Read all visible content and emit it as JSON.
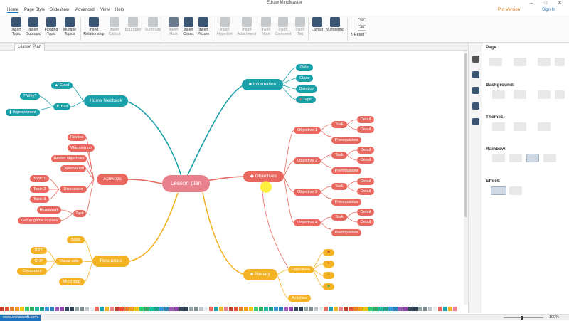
{
  "window": {
    "title": "Edraw MindMaster"
  },
  "menu": {
    "items": [
      "Home",
      "Page Style",
      "Slideshow",
      "Advanced",
      "View",
      "Help"
    ],
    "pro_version": "Pro Version",
    "sign_in": "Sign In"
  },
  "ribbon": {
    "insert_topic": "Insert Topic",
    "insert_subtopic": "Insert Subtopic",
    "floating_topic": "Floating Topic",
    "multiple_topics": "Multiple Topics",
    "insert_relationship": "Insert Relationship",
    "insert_callout": "Insert Callout",
    "boundary": "Boundary",
    "summary": "Summary",
    "insert_mark": "Insert Mark",
    "insert_clipart": "Insert Clipart",
    "insert_picture": "Insert Picture",
    "insert_hyperlink": "Insert Hyperlink",
    "insert_attachment": "Insert Attachment",
    "insert_note": "Insert Note",
    "insert_comment": "Insert Comment",
    "insert_tag": "Insert Tag",
    "layout": "Layout",
    "numbering": "Numbering",
    "spacing_h": "50",
    "spacing_v": "40",
    "reset": "Reset"
  },
  "tabs": [
    "Lesson Plan"
  ],
  "mindmap": {
    "central": "Lesson plan",
    "home_feedback": "Home feedback",
    "good": "Good",
    "bad": "Bad",
    "why": "Why?",
    "improvement": "Improvement",
    "information": "Information",
    "date": "Date",
    "class": "Class",
    "duration": "Duration",
    "topic": "Topic",
    "activities": "Activities",
    "review": "Review",
    "warming_up": "Warming up",
    "revisit_objectives": "Revisit objectives",
    "observation": "Observation",
    "discussion": "Discussion",
    "topic1": "Topic 1",
    "topic2": "Topic 2",
    "topic3": "Topic 3",
    "task": "Task",
    "homework": "Homework",
    "group_game": "Group game in class",
    "resources": "Resources",
    "book": "Book",
    "visual_aids": "Visual aids",
    "ppt": "PPT",
    "ohp": "OHP",
    "computers": "Computers",
    "mind_map": "Mind map",
    "objectives": "Objectives",
    "objective1": "Objective 1",
    "objective2": "Objective 2",
    "objective3": "Objective 3",
    "objective4": "Objective 4",
    "task_label": "Task",
    "detail": "Detail",
    "prerequisites": "Prerequisites",
    "plenary": "Plenary",
    "plenary_objectives": "Objectives",
    "plenary_activities": "Activities"
  },
  "panel": {
    "page": "Page",
    "background": "Background:",
    "themes": "Themes:",
    "rainbow": "Rainbow:",
    "effect": "Effect:"
  },
  "status": {
    "url": "www.edrawsoft.com",
    "zoom": "100%"
  },
  "colors": {
    "teal": "#1aa0a8",
    "coral": "#e8675e",
    "orange": "#f4b324",
    "pink": "#e9818c",
    "blue": "#1e73be"
  }
}
